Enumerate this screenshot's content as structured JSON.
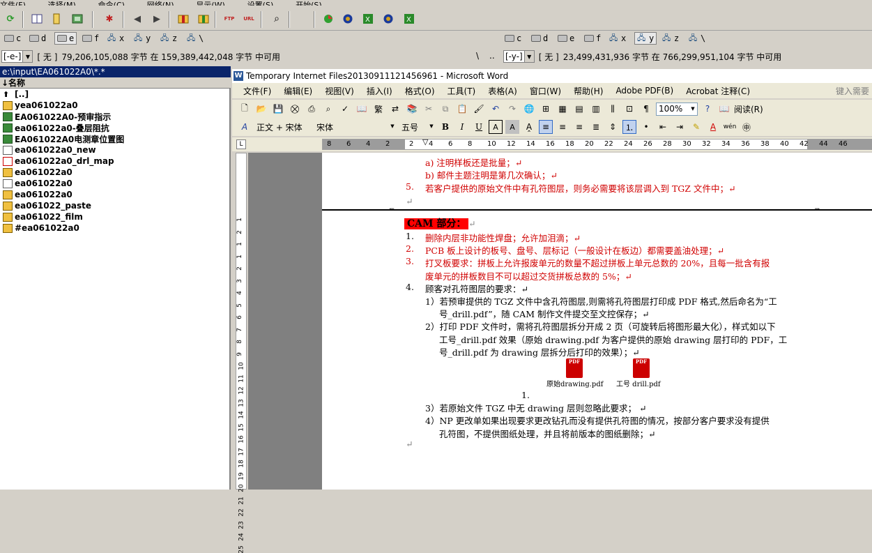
{
  "tc": {
    "menu": [
      "文件(F)",
      "选择(M)",
      "命令(C)",
      "网络(N)",
      "显示(W)",
      "设置(S)",
      "开始(S)"
    ],
    "left_drives": [
      "c",
      "d",
      "e",
      "f",
      "x",
      "y",
      "z",
      "\\"
    ],
    "right_drives": [
      "c",
      "d",
      "e",
      "f",
      "x",
      "y",
      "z",
      "\\"
    ],
    "left_combo": "[-e-]",
    "left_label": "[ 无 ]",
    "left_free": "79,206,105,088 字节 在 159,389,442,048 字节 中可用",
    "mid_sep1": "\\",
    "mid_sep2": "..",
    "right_combo": "[-y-]",
    "right_label": "[ 无 ]",
    "right_free": "23,499,431,936 字节 在 766,299,951,104 字节 中可用",
    "path": "e:\\input\\EA061022A0\\*.*",
    "column_header": "↓名称",
    "files": [
      {
        "icon": "up",
        "name": "[..]"
      },
      {
        "icon": "arc",
        "name": "yea061022a0"
      },
      {
        "icon": "xl",
        "name": "EA061022A0-预审指示"
      },
      {
        "icon": "xl",
        "name": "ea061022a0-叠层阻抗"
      },
      {
        "icon": "xl",
        "name": "EA061022A0电测章位置图"
      },
      {
        "icon": "txt",
        "name": "ea061022a0_new"
      },
      {
        "icon": "pdf",
        "name": "ea061022a0_drl_map"
      },
      {
        "icon": "arc",
        "name": "ea061022a0"
      },
      {
        "icon": "txt",
        "name": "ea061022a0"
      },
      {
        "icon": "arc",
        "name": "ea061022a0"
      },
      {
        "icon": "arc",
        "name": "ea061022_paste"
      },
      {
        "icon": "arc",
        "name": "ea061022_film"
      },
      {
        "icon": "arc",
        "name": "#ea061022a0"
      }
    ]
  },
  "word": {
    "title": "Temporary Internet Files20130911121456961 - Microsoft Word",
    "menu": [
      "文件(F)",
      "编辑(E)",
      "视图(V)",
      "插入(I)",
      "格式(O)",
      "工具(T)",
      "表格(A)",
      "窗口(W)",
      "帮助(H)",
      "Adobe PDF(B)",
      "Acrobat 注释(C)"
    ],
    "help_box": "键入需要",
    "zoom": "100%",
    "read_label": "阅读(R)",
    "style_name": "正文 + 宋体",
    "font_name": "宋体",
    "font_size": "五号",
    "ruler_numbers": [
      "8",
      "6",
      "4",
      "2",
      "2",
      "4",
      "6",
      "8",
      "10",
      "12",
      "14",
      "16",
      "18",
      "20",
      "22",
      "24",
      "26",
      "28",
      "30",
      "32",
      "34",
      "36",
      "38",
      "40",
      "42",
      "44",
      "46"
    ],
    "vruler_numbers": [
      "1",
      "2",
      "1",
      "1",
      "2",
      "3",
      "4",
      "5",
      "6",
      "7",
      "8",
      "9",
      "10",
      "11",
      "12",
      "13",
      "14",
      "15",
      "16",
      "17",
      "18",
      "19",
      "20",
      "21",
      "22",
      "23",
      "24",
      "25"
    ],
    "doc": {
      "l_a": "a)  注明样板还是批量；↵",
      "l_b": "b)  邮件主题注明是第几次确认；↵",
      "l_5_num": "5.",
      "l_5": "若客户提供的原始文件中有孔符图层，则务必需要将该层调入到 TGZ 文件中；↵",
      "l_empty1": "↵",
      "cam_title": "CAM 部分：",
      "cam_mark": "↵",
      "i1_num": "1.",
      "i1": "删除内层非功能性焊盘；允许加泪滴；↵",
      "i2_num": "2.",
      "i2": "PCB 板上设计的板号、盘号、层标记（一般设计在板边）都需要盖油处理；↵",
      "i3_num": "3.",
      "i3a": "打叉板要求：拼板上允许报废单元的数量不超过拼板上单元总数的 20%，且每一批含有报",
      "i3b": "废单元的拼板数目不可以超过交货拼板总数的 5%；↵",
      "i4_num": "4.",
      "i4": "顾客对孔符图层的要求：↵",
      "s1a": "1）若预审提供的 TGZ 文件中含孔符图层,则需将孔符图层打印成 PDF 格式,然后命名为“工",
      "s1b": "号_drill.pdf”，随 CAM 制作文件提交至文控保存；↵",
      "s2a": "2）打印 PDF 文件时，需将孔符图层拆分开成 2 页（可旋转后将图形最大化），样式如以下",
      "s2b": "工号_drill.pdf 效果（原始 drawing.pdf 为客户提供的原始 drawing 层打印的 PDF，工",
      "s2c": "号_drill.pdf 为 drawing 层拆分后打印的效果）；↵",
      "pdf1_label": "原始drawing.pdf",
      "pdf2_label": "工号 drill.pdf",
      "pdf_icon_text": "PDF",
      "num_under": "1.",
      "s3": "3）若原始文件 TGZ 中无 drawing 层则忽略此要求；  ↵",
      "s4a": "4）NP 更改单如果出现要求更改钻孔而没有提供孔符图的情况，按部分客户要求没有提供",
      "s4b": "孔符图，不提供图纸处理，并且将前版本的图纸删除；↵",
      "l_end": "↵"
    }
  }
}
